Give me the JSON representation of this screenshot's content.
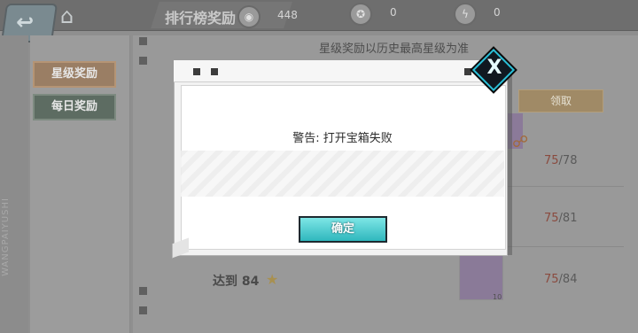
{
  "header": {
    "title": "排行榜奖励",
    "resources": [
      {
        "icon": "coin-icon",
        "value": "448"
      },
      {
        "icon": "gear-coin-icon",
        "value": "0"
      },
      {
        "icon": "bolt-coin-icon",
        "value": "0"
      }
    ]
  },
  "sidebar": {
    "tabs": [
      {
        "label": "星级奖励"
      },
      {
        "label": "每日奖励"
      }
    ],
    "watermark": "WANGPAIYUSHI"
  },
  "list": {
    "header": "星级奖励以历史最高星级为准",
    "claim_label": "领取",
    "rows": [
      {
        "current": "75",
        "target": "/78"
      },
      {
        "current": "75",
        "target": "/81"
      },
      {
        "current": "75",
        "target": "/84"
      }
    ],
    "reach_label": "达到 84",
    "reward_count": "10"
  },
  "dialog": {
    "message": "警告: 打开宝箱失败",
    "confirm_label": "确定",
    "close_label": "X"
  },
  "colors": {
    "accent_cyan": "#2fb7bd",
    "close_border": "#2ac0d8",
    "progress_red": "#7a4a3e"
  }
}
